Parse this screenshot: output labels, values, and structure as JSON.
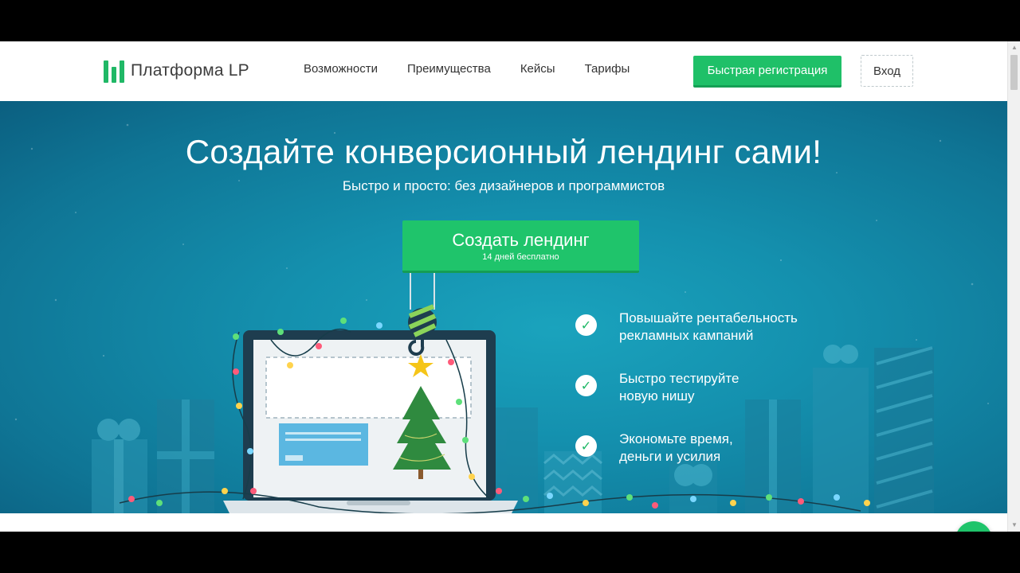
{
  "header": {
    "logo_text": "Платформа LP",
    "nav": [
      "Возможности",
      "Преимущества",
      "Кейсы",
      "Тарифы"
    ],
    "register_label": "Быстрая регистрация",
    "login_label": "Вход"
  },
  "hero": {
    "title": "Создайте конверсионный лендинг сами!",
    "subtitle": "Быстро и просто: без дизайнеров и программистов",
    "cta_main": "Создать лендинг",
    "cta_sub": "14 дней бесплатно",
    "features": [
      {
        "line1": "Повышайте рентабельность",
        "line2": "рекламных кампаний"
      },
      {
        "line1": "Быстро тестируйте",
        "line2": "новую нишу"
      },
      {
        "line1": "Экономьте время,",
        "line2": "деньги и усилия"
      }
    ]
  },
  "colors": {
    "brand_green": "#1fc068",
    "hero_blue": "#1490ae"
  },
  "icons": [
    "logo-mark-icon",
    "check-icon",
    "chat-icon",
    "christmas-tree-icon",
    "star-icon",
    "laptop-icon",
    "crane-hook-icon",
    "gift-icon"
  ]
}
